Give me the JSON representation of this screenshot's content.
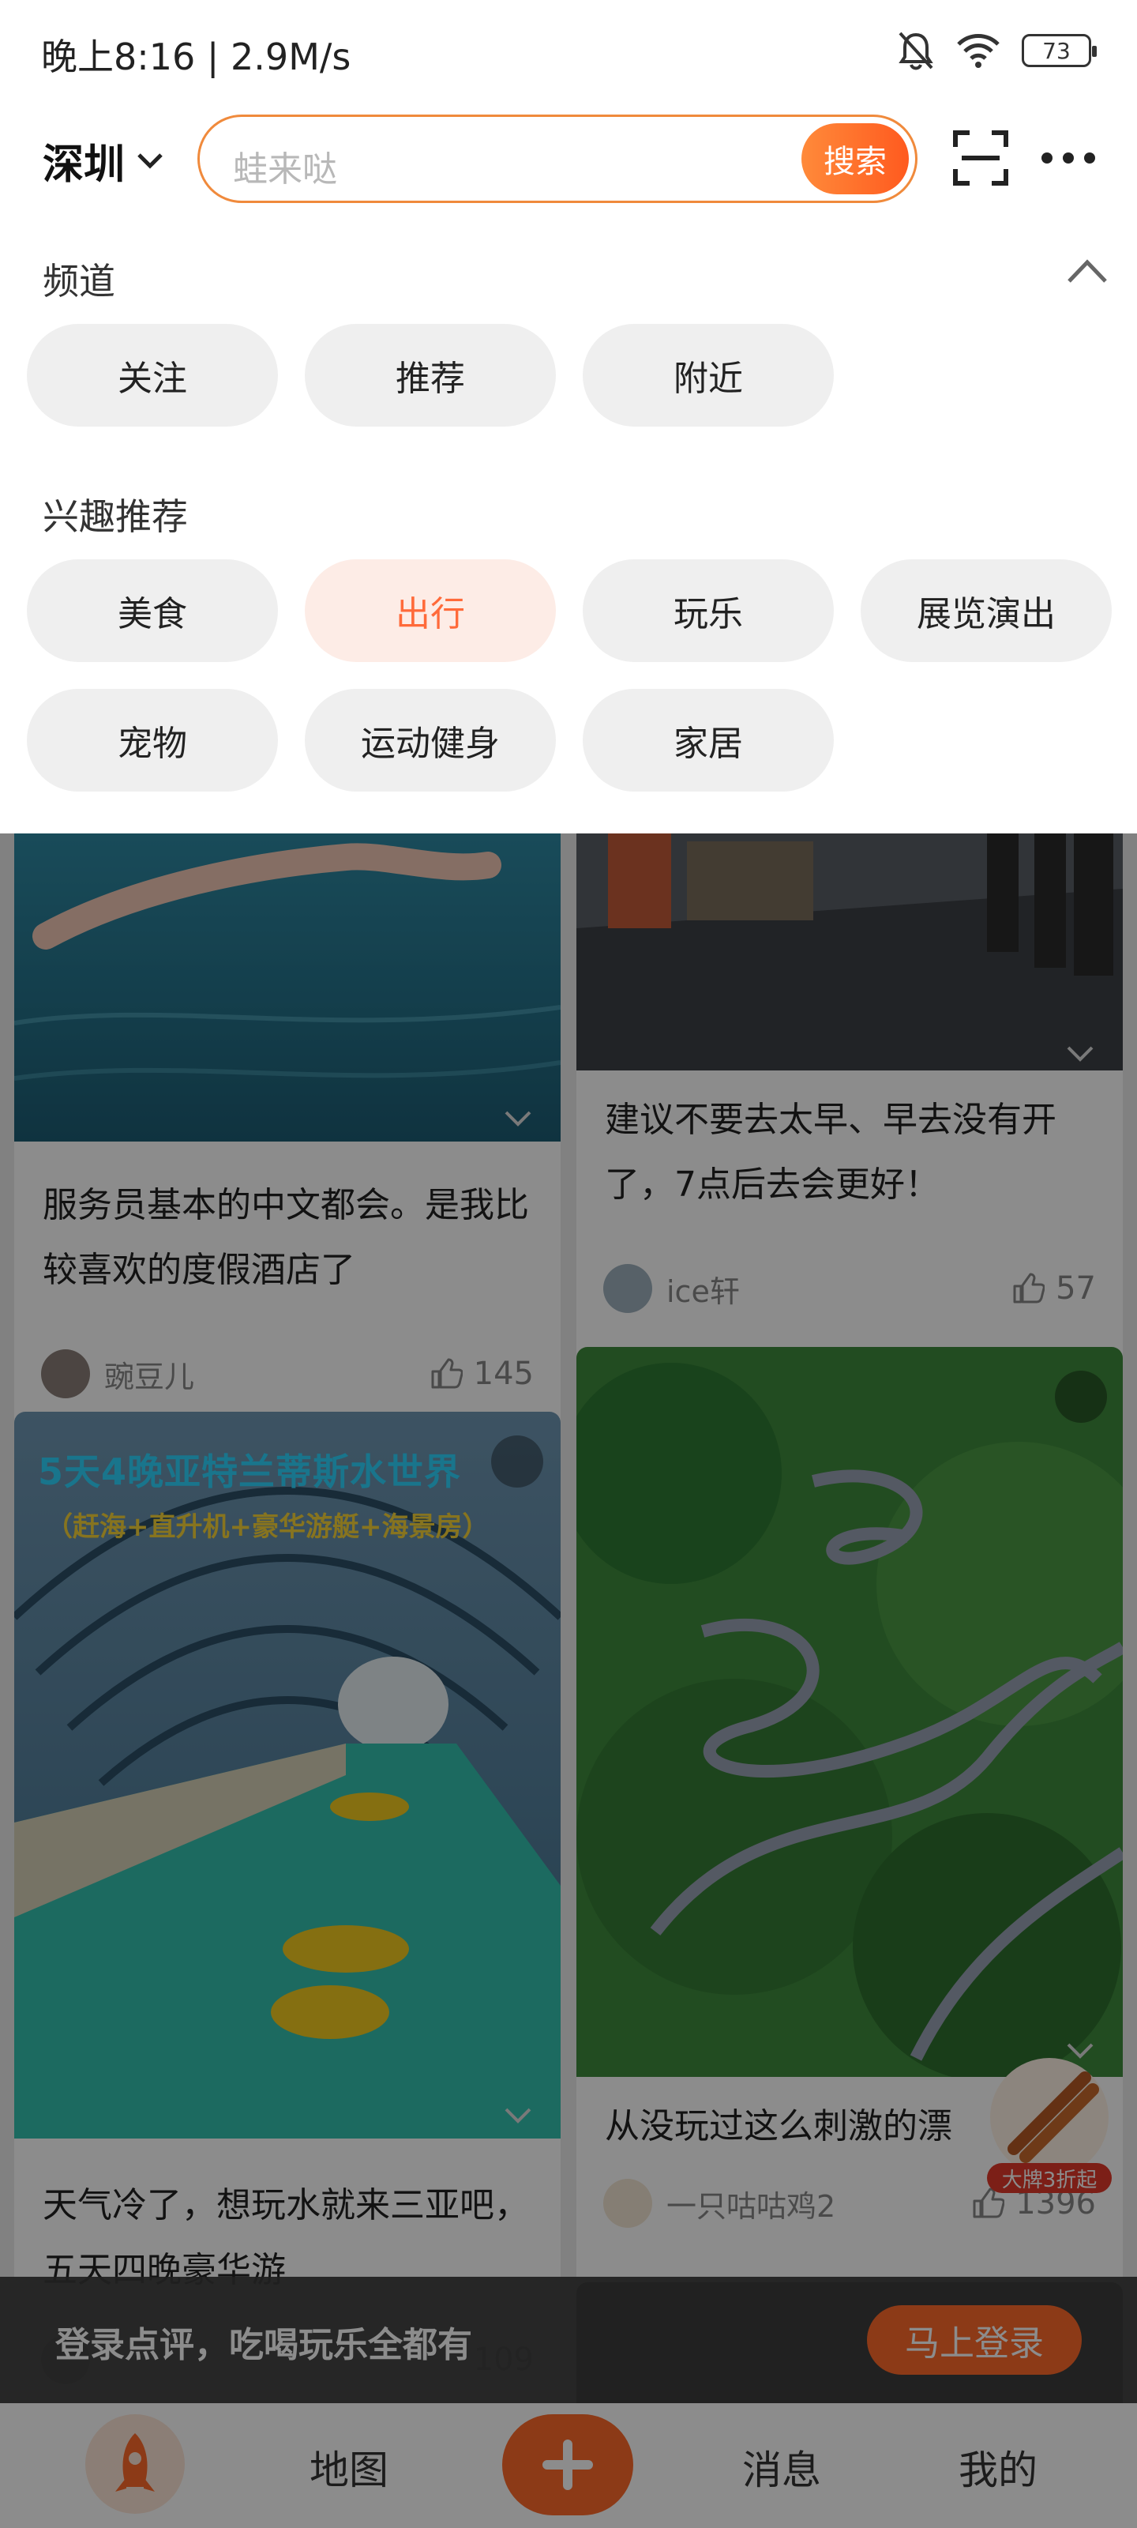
{
  "status_bar": {
    "text": "晚上8:16 | 2.9M/s",
    "battery": "73"
  },
  "header": {
    "city": "深圳",
    "search_placeholder": "蛙来哒",
    "search_button": "搜索"
  },
  "channels": {
    "title": "频道",
    "items": [
      "关注",
      "推荐",
      "附近"
    ]
  },
  "interests": {
    "title": "兴趣推荐",
    "items": [
      "美食",
      "出行",
      "玩乐",
      "展览演出",
      "宠物",
      "运动健身",
      "家居"
    ],
    "active": "出行"
  },
  "feed": {
    "left": [
      {
        "title": "服务员基本的中文都会。是我比较喜欢的度假酒店了",
        "author": "豌豆儿",
        "likes": "145"
      },
      {
        "title": "天气冷了，想玩水就来三亚吧，五天四晚豪华游",
        "overlay_title": "5天4晚亚特兰蒂斯水世界",
        "overlay_sub": "（赶海+直升机+豪华游艇+海景房）",
        "likes": "109"
      }
    ],
    "right": [
      {
        "title": "建议不要去太早、早去没有开了，7点后去会更好！",
        "author": "ice轩",
        "likes": "57"
      },
      {
        "title": "从没玩过这么刺激的漂",
        "author": "一只咕咕鸡2",
        "likes": "1396"
      }
    ]
  },
  "ad_badge": "大牌3折起",
  "login_bar": {
    "text": "登录点评，吃喝玩乐全都有",
    "button": "马上登录"
  },
  "tabbar": {
    "map": "地图",
    "messages": "消息",
    "mine": "我的"
  },
  "colors": {
    "accent": "#ff6a2a",
    "chip_active_bg": "#fdece6",
    "search_border": "#f08a3c"
  }
}
